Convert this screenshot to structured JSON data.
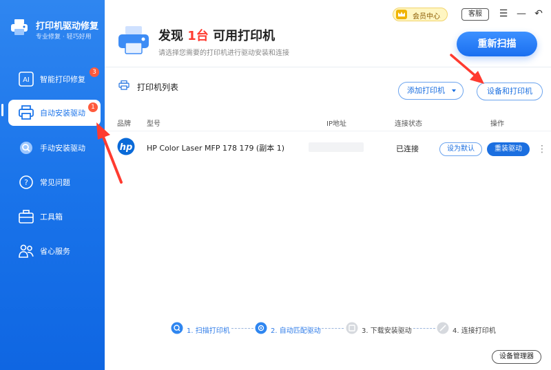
{
  "brand": {
    "title": "打印机驱动修复",
    "subtitle": "专业修复 · 轻巧好用"
  },
  "sidebar": {
    "items": [
      {
        "label": "智能打印修复",
        "badge": "3",
        "icon": "ai-icon"
      },
      {
        "label": "自动安装驱动",
        "badge": "1",
        "icon": "printer-icon"
      },
      {
        "label": "手动安装驱动",
        "icon": "search-icon"
      },
      {
        "label": "常见问题",
        "icon": "question-icon"
      },
      {
        "label": "工具箱",
        "icon": "toolbox-icon"
      },
      {
        "label": "省心服务",
        "icon": "people-icon"
      }
    ]
  },
  "topbar": {
    "vip_label": "会员中心",
    "service_label": "客服",
    "menu_glyph": "☰",
    "minimize_glyph": "—",
    "back_glyph": "↶"
  },
  "header": {
    "title_prefix": "发现 ",
    "title_count": "1台",
    "title_suffix": " 可用打印机",
    "subtitle": "请选择您需要的打印机进行驱动安装和连接"
  },
  "rescan_label": "重新扫描",
  "list": {
    "title": "打印机列表",
    "add_label": "添加打印机",
    "devices_label": "设备和打印机",
    "columns": [
      "品牌",
      "型号",
      "IP地址",
      "连接状态",
      "操作"
    ],
    "rows": [
      {
        "brand_logo": "hp",
        "model": "HP Color Laser MFP 178 179 (副本 1)",
        "status": "已连接",
        "set_default": "设为默认",
        "reinstall": "重装驱动",
        "more": "⋮"
      }
    ]
  },
  "steps": [
    "1. 扫描打印机",
    "2. 自动匹配驱动",
    "3. 下载安装驱动",
    "4. 连接打印机"
  ],
  "device_manager_label": "设备管理器",
  "colors": {
    "accent": "#1b6fe0",
    "sidebar": "#1a74ea",
    "badge": "#ff5a3c",
    "highlight": "#ff3b30",
    "arrow": "#ff3b30"
  }
}
